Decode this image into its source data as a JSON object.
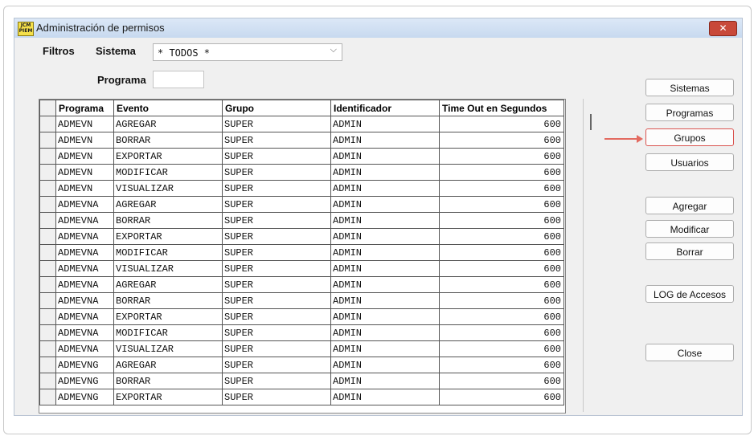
{
  "window": {
    "title": "Administración de permisos",
    "icon_text": "JCM PIEM"
  },
  "filters": {
    "filtros_label": "Filtros",
    "sistema_label": "Sistema",
    "sistema_value": "* TODOS *",
    "programa_label": "Programa",
    "programa_value": ""
  },
  "table": {
    "columns": [
      "Programa",
      "Evento",
      "Grupo",
      "Identificador",
      "Time Out en Segundos"
    ],
    "rows": [
      [
        "ADMEVN",
        "AGREGAR",
        "SUPER",
        "ADMIN",
        "600"
      ],
      [
        "ADMEVN",
        "BORRAR",
        "SUPER",
        "ADMIN",
        "600"
      ],
      [
        "ADMEVN",
        "EXPORTAR",
        "SUPER",
        "ADMIN",
        "600"
      ],
      [
        "ADMEVN",
        "MODIFICAR",
        "SUPER",
        "ADMIN",
        "600"
      ],
      [
        "ADMEVN",
        "VISUALIZAR",
        "SUPER",
        "ADMIN",
        "600"
      ],
      [
        "ADMEVNA",
        "AGREGAR",
        "SUPER",
        "ADMIN",
        "600"
      ],
      [
        "ADMEVNA",
        "BORRAR",
        "SUPER",
        "ADMIN",
        "600"
      ],
      [
        "ADMEVNA",
        "EXPORTAR",
        "SUPER",
        "ADMIN",
        "600"
      ],
      [
        "ADMEVNA",
        "MODIFICAR",
        "SUPER",
        "ADMIN",
        "600"
      ],
      [
        "ADMEVNA",
        "VISUALIZAR",
        "SUPER",
        "ADMIN",
        "600"
      ],
      [
        "ADMEVNA",
        "AGREGAR",
        "SUPER",
        "ADMIN",
        "600"
      ],
      [
        "ADMEVNA",
        "BORRAR",
        "SUPER",
        "ADMIN",
        "600"
      ],
      [
        "ADMEVNA",
        "EXPORTAR",
        "SUPER",
        "ADMIN",
        "600"
      ],
      [
        "ADMEVNA",
        "MODIFICAR",
        "SUPER",
        "ADMIN",
        "600"
      ],
      [
        "ADMEVNA",
        "VISUALIZAR",
        "SUPER",
        "ADMIN",
        "600"
      ],
      [
        "ADMEVNG",
        "AGREGAR",
        "SUPER",
        "ADMIN",
        "600"
      ],
      [
        "ADMEVNG",
        "BORRAR",
        "SUPER",
        "ADMIN",
        "600"
      ],
      [
        "ADMEVNG",
        "EXPORTAR",
        "SUPER",
        "ADMIN",
        "600"
      ]
    ]
  },
  "buttons": {
    "sistemas": "Sistemas",
    "programas": "Programas",
    "grupos": "Grupos",
    "usuarios": "Usuarios",
    "agregar": "Agregar",
    "modificar": "Modificar",
    "borrar": "Borrar",
    "log": "LOG de Accesos",
    "close": "Close"
  },
  "colors": {
    "highlight_arrow": "#e36a60",
    "focused_button_border": "#d9534f"
  },
  "icons": {
    "close": "close-icon",
    "combo": "chevron-down-icon",
    "arrow": "arrow-right-icon"
  }
}
